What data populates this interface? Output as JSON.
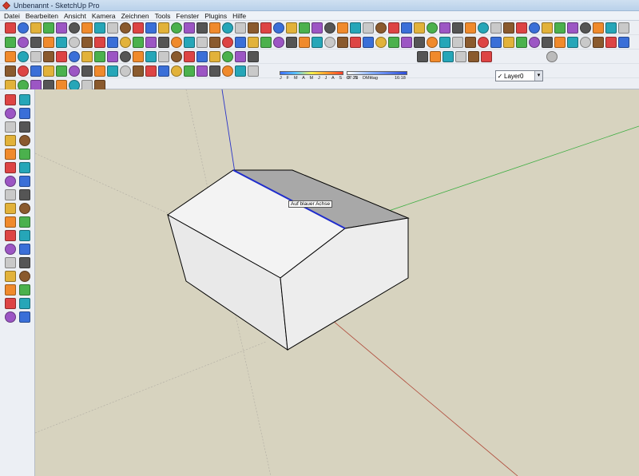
{
  "window": {
    "title": "Unbenannt - SketchUp Pro"
  },
  "menu": [
    "Datei",
    "Bearbeiten",
    "Ansicht",
    "Kamera",
    "Zeichnen",
    "Tools",
    "Fenster",
    "Plugins",
    "Hilfe"
  ],
  "shadow_settings": {
    "months": "J F M A M J J A S O N D",
    "time_start": "07:21",
    "time_mid": "Mittag",
    "time_end": "16:18"
  },
  "layer": {
    "current": "Layer0",
    "check": "✓",
    "dropdown": "▾"
  },
  "viewport": {
    "tooltip": "Auf blauer Achse"
  },
  "colors": {
    "background": "#d7d3bf",
    "blue_axis": "#2a34c8",
    "red_axis": "#b04a3a",
    "green_axis": "#3fae43",
    "face_light": "#f1f1f1",
    "face_shade": "#a9a9a9",
    "selected_edge": "#1f2ccc"
  },
  "toolbar_icons": [
    "select-icon",
    "pencil-icon",
    "rectangle-icon",
    "circle-icon",
    "arc-icon",
    "eraser-icon",
    "paint-bucket-icon",
    "pushpull-icon",
    "move-icon",
    "rotate-icon",
    "scale-icon",
    "offset-icon",
    "tape-measure-icon",
    "protractor-icon",
    "text-icon",
    "axes-icon",
    "orbit-icon",
    "pan-icon",
    "zoom-icon",
    "zoom-extents-icon"
  ],
  "left_tools": [
    "select-tool-icon",
    "make-component-icon",
    "paint-bucket-tool-icon",
    "eraser-tool-icon",
    "rectangle-tool-icon",
    "line-tool-icon",
    "circle-tool-icon",
    "arc-tool-icon",
    "polygon-tool-icon",
    "freehand-tool-icon",
    "move-tool-icon",
    "pushpull-tool-icon",
    "rotate-tool-icon",
    "followme-tool-icon",
    "scale-tool-icon",
    "offset-tool-icon",
    "tape-tool-icon",
    "dimension-tool-icon",
    "protractor-tool-icon",
    "text-tool-icon",
    "axes-tool-icon",
    "3dtext-tool-icon",
    "orbit-tool-icon",
    "pan-tool-icon",
    "zoom-tool-icon",
    "zoom-window-icon",
    "zoom-extents-tool-icon",
    "previous-view-icon",
    "position-camera-icon",
    "walk-icon",
    "footprints-icon",
    "look-around-icon",
    "section-plane-icon",
    "section-display-icon"
  ]
}
